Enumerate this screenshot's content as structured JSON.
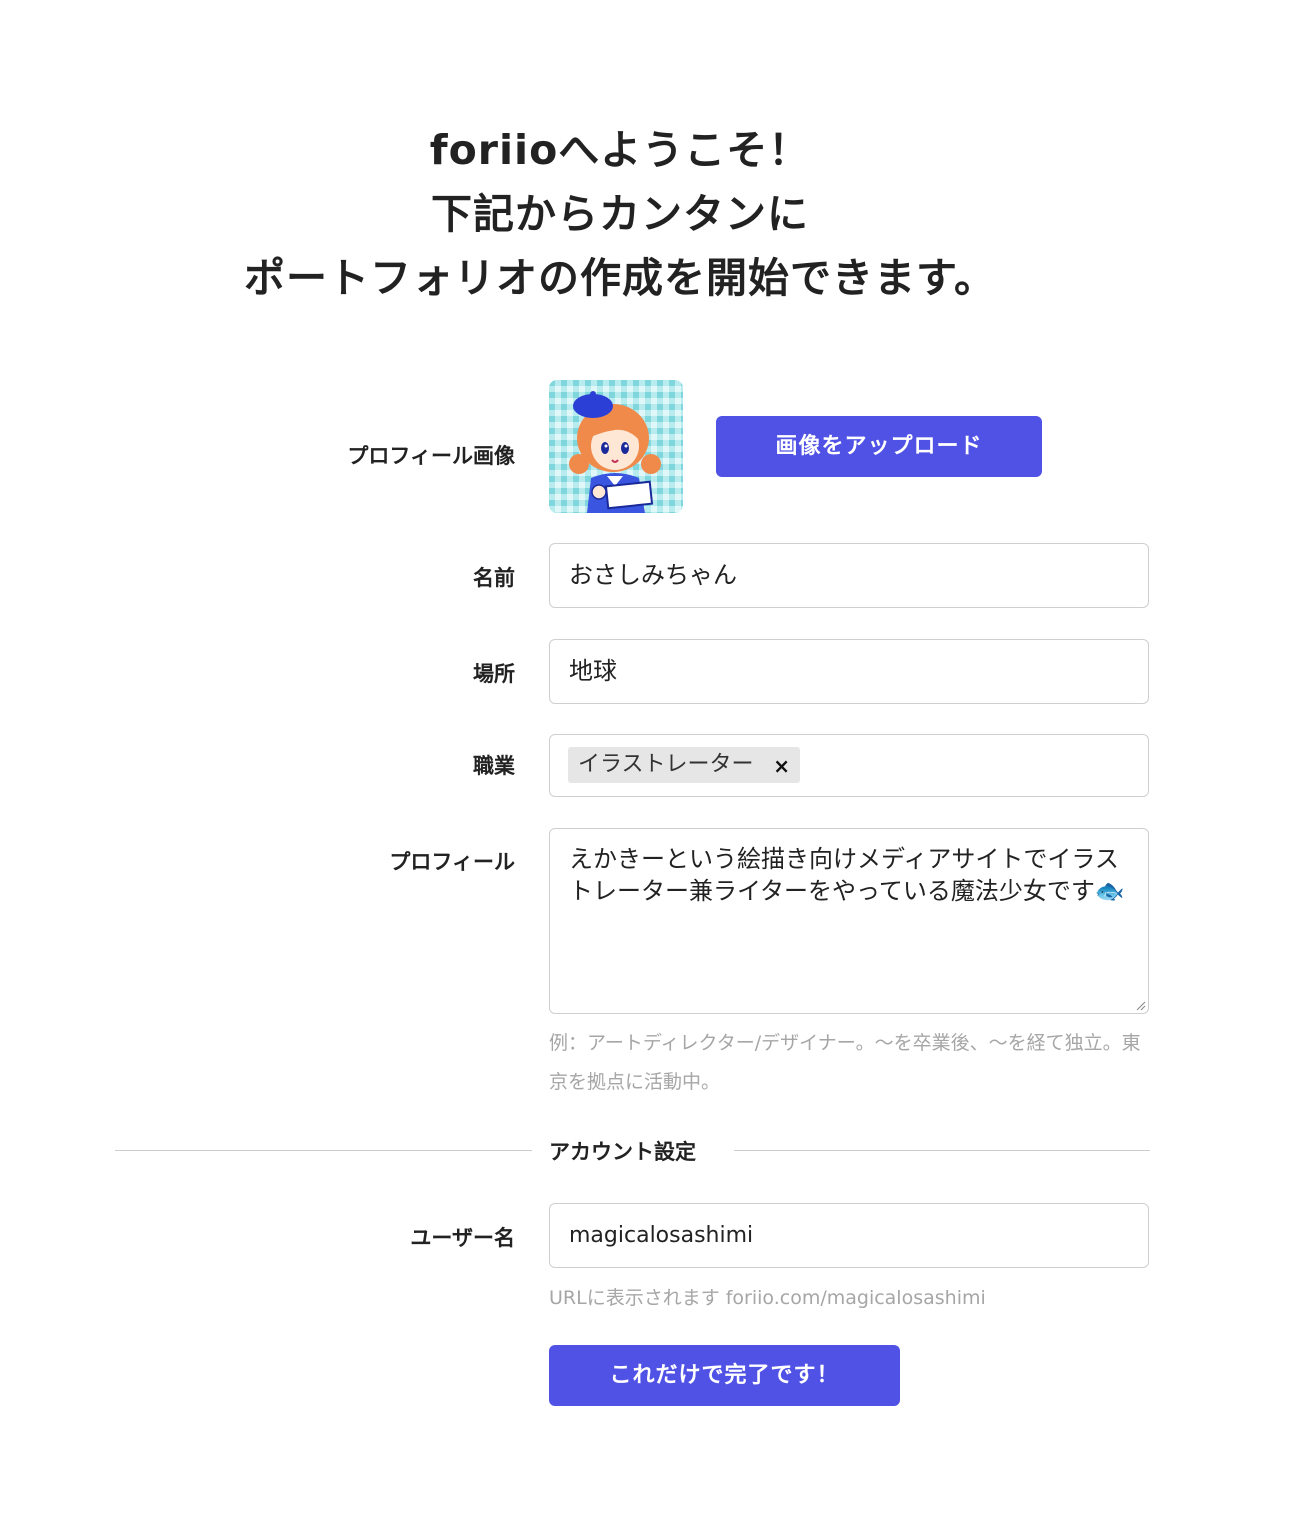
{
  "heading": {
    "line1": "foriioへようこそ！",
    "line2": "下記からカンタンに",
    "line3": "ポートフォリオの作成を開始できます。"
  },
  "profile_image": {
    "label": "プロフィール画像",
    "upload_button": "画像をアップロード"
  },
  "name": {
    "label": "名前",
    "value": "おさしみちゃん"
  },
  "location": {
    "label": "場所",
    "value": "地球"
  },
  "occupation": {
    "label": "職業",
    "tags": [
      {
        "text": "イラストレーター",
        "remove": "×"
      }
    ]
  },
  "profile": {
    "label": "プロフィール",
    "value": "えかきーという絵描き向けメディアサイトでイラストレーター兼ライターをやっている魔法少女です🐟",
    "hint": "例：アートディレクター/デザイナー。〜を卒業後、〜を経て独立。東京を拠点に活動中。"
  },
  "account_section": {
    "title": "アカウント設定"
  },
  "username": {
    "label": "ユーザー名",
    "value": "magicalosashimi",
    "hint": "URLに表示されます foriio.com/magicalosashimi"
  },
  "submit_button": "これだけで完了です！",
  "colors": {
    "accent": "#5052e6",
    "avatar_bg": "#bfeff0"
  },
  "icons": {
    "avatar": "illustrated-girl-avatar",
    "tag_remove": "close-icon",
    "resize": "resize-handle-icon"
  }
}
